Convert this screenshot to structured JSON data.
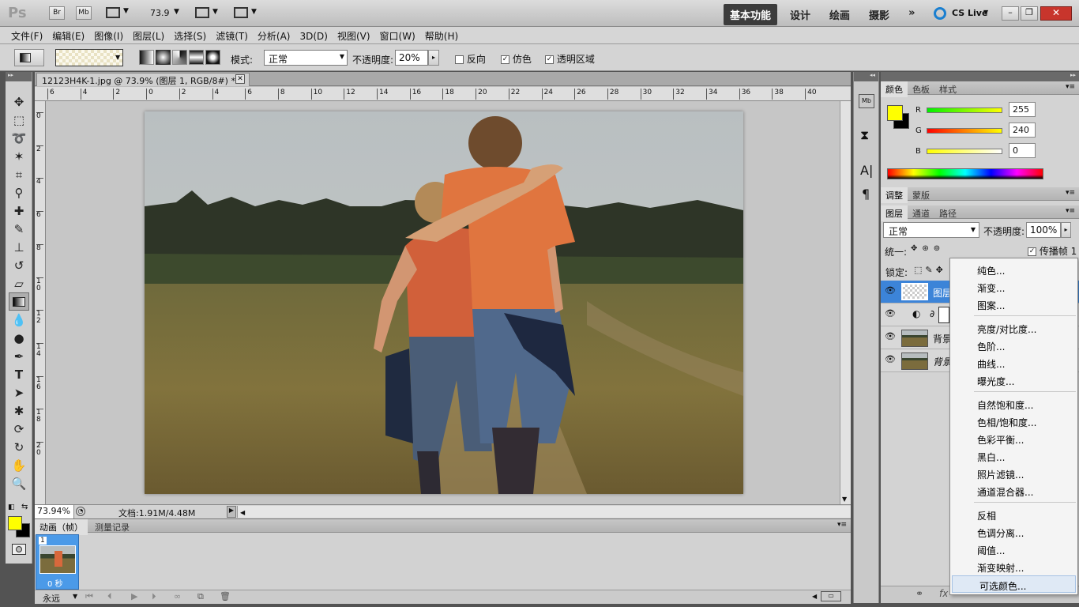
{
  "app": {
    "logo": "Ps",
    "br": "Br",
    "mb": "Mb",
    "zoom_value": "73.9"
  },
  "workspaces": [
    "基本功能",
    "设计",
    "绘画",
    "摄影"
  ],
  "cslive": "CS Live",
  "menu": [
    "文件(F)",
    "编辑(E)",
    "图像(I)",
    "图层(L)",
    "选择(S)",
    "滤镜(T)",
    "分析(A)",
    "3D(D)",
    "视图(V)",
    "窗口(W)",
    "帮助(H)"
  ],
  "options": {
    "mode_label": "模式:",
    "mode_value": "正常",
    "opacity_label": "不透明度:",
    "opacity_value": "20%",
    "reverse": "反向",
    "dither": "仿色",
    "transparency": "透明区域"
  },
  "doc": {
    "tab_title": "12123H4K-1.jpg @ 73.9% (图层 1, RGB/8#) *",
    "ruler_h": [
      "6",
      "4",
      "2",
      "0",
      "2",
      "4",
      "6",
      "8",
      "10",
      "12",
      "14",
      "16",
      "18",
      "20",
      "22",
      "24",
      "26",
      "28",
      "30",
      "32",
      "34",
      "36",
      "38",
      "40"
    ],
    "ruler_v": [
      "0",
      "2",
      "4",
      "6",
      "8",
      "1 0",
      "1 2",
      "1 4",
      "1 6",
      "1 8",
      "2 0"
    ],
    "zoom_status": "73.94%",
    "doc_info": "文档:1.91M/4.48M"
  },
  "animation": {
    "tab1": "动画（帧）",
    "tab2": "测量记录",
    "frame_num": "1",
    "frame_time": "0 秒",
    "loop": "永远"
  },
  "color_panel": {
    "tabs": [
      "颜色",
      "色板",
      "样式"
    ],
    "r_label": "R",
    "g_label": "G",
    "b_label": "B",
    "r": "255",
    "g": "240",
    "b": "0",
    "fg": "#ffff00",
    "bg": "#000000"
  },
  "adjust_panel": {
    "tabs": [
      "调整",
      "蒙版"
    ]
  },
  "layers_panel": {
    "tabs": [
      "图层",
      "通道",
      "路径"
    ],
    "blend": "正常",
    "opacity_label": "不透明度:",
    "opacity": "100%",
    "unify": "统一:",
    "propagate": "传播帧 1",
    "lock": "锁定:",
    "layers": [
      "图层",
      "",
      "背景",
      "背景"
    ]
  },
  "dropdown": {
    "group1": [
      "纯色...",
      "渐变...",
      "图案..."
    ],
    "group2": [
      "亮度/对比度...",
      "色阶...",
      "曲线...",
      "曝光度..."
    ],
    "group3": [
      "自然饱和度...",
      "色相/饱和度...",
      "色彩平衡...",
      "黑白...",
      "照片滤镜...",
      "通道混合器..."
    ],
    "group4": [
      "反相",
      "色调分离...",
      "阈值...",
      "渐变映射...",
      "可选颜色..."
    ]
  }
}
